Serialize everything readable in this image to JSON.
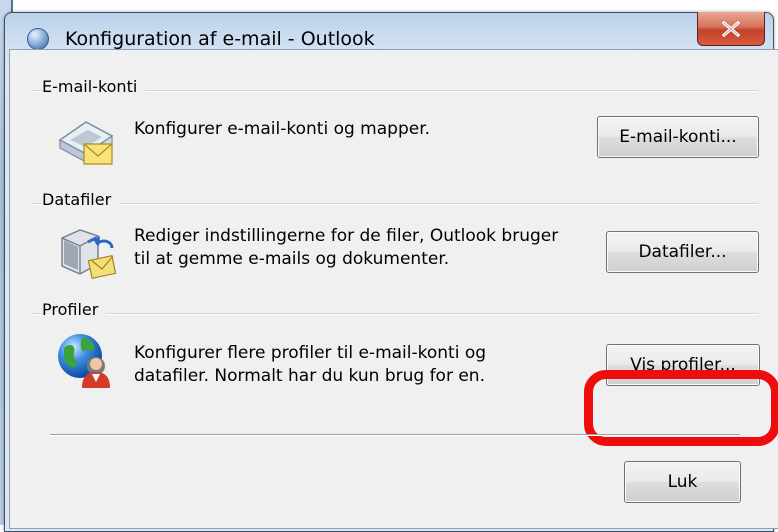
{
  "window": {
    "title": "Konfiguration af e-mail - Outlook",
    "close_label": "Close"
  },
  "sections": [
    {
      "group_label": "E-mail-konti",
      "description": "Konfigurer e-mail-konti og mapper.",
      "button_label": "E-mail-konti..."
    },
    {
      "group_label": "Datafiler",
      "description_line1": "Rediger indstillingerne for de filer, Outlook bruger",
      "description_line2": "til at gemme e-mails og dokumenter.",
      "button_label": "Datafiler..."
    },
    {
      "group_label": "Profiler",
      "description_line1": "Konfigurer flere profiler til e-mail-konti og",
      "description_line2": "datafiler. Normalt har du kun brug for en.",
      "button_label": "Vis profiler..."
    }
  ],
  "footer": {
    "close_button_label": "Luk"
  },
  "annotation": {
    "highlight_color": "#ee0d0d"
  }
}
